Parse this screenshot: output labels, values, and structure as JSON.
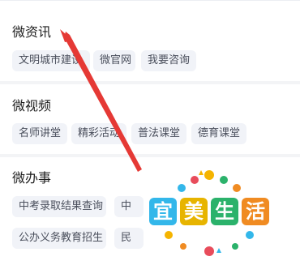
{
  "sections": [
    {
      "title": "微资讯",
      "chips": [
        "文明城市建设",
        "微官网",
        "我要咨询"
      ]
    },
    {
      "title": "微视频",
      "chips": [
        "名师讲堂",
        "精彩活动",
        "普法课堂",
        "德育课堂"
      ]
    },
    {
      "title": "微办事",
      "chips": [
        "中考录取结果查询",
        "中",
        "公办义务教育招生",
        "民"
      ]
    }
  ],
  "logo": {
    "chars": [
      "宜",
      "美",
      "生",
      "活"
    ],
    "tile_colors": [
      "#33b7ea",
      "#e7b400",
      "#2bb26b",
      "#f08b22"
    ]
  },
  "annotation": {
    "arrow_color": "#e53935"
  }
}
